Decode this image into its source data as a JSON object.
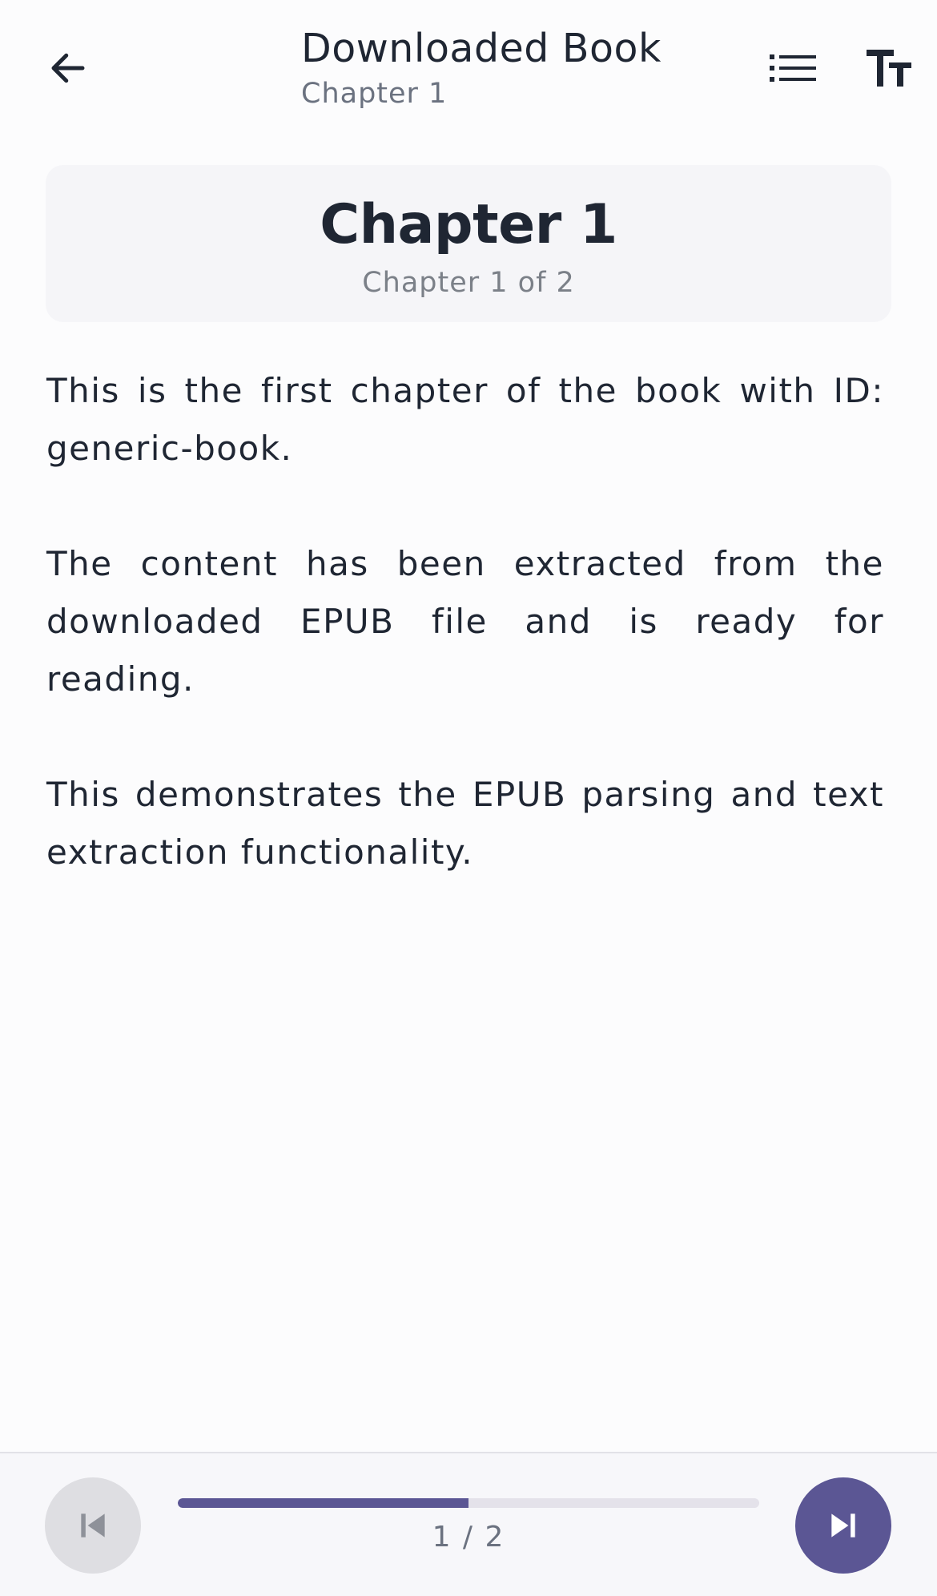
{
  "header": {
    "title": "Downloaded Book",
    "subtitle": "Chapter 1",
    "back_icon": "arrow-left-icon",
    "toc_icon": "list-icon",
    "font_icon": "text-size-icon"
  },
  "chapter": {
    "heading": "Chapter 1",
    "progress_label": "Chapter 1 of 2"
  },
  "content": {
    "paragraphs": [
      "This is the first chapter of the book with ID: generic-book.",
      "The content has been extracted from the downloaded EPUB file and is ready for reading.",
      "This demonstrates the EPUB parsing and text extraction functionality."
    ]
  },
  "footer": {
    "page_indicator": "1 / 2",
    "progress_fraction": 0.5,
    "prev_icon": "skip-previous-icon",
    "next_icon": "skip-next-icon",
    "prev_enabled": false,
    "next_enabled": true
  },
  "colors": {
    "accent": "#5b5694",
    "text": "#1f2633",
    "muted": "#6b7280",
    "disabled_button": "#dedee2",
    "card_background": "#f5f5f8"
  }
}
